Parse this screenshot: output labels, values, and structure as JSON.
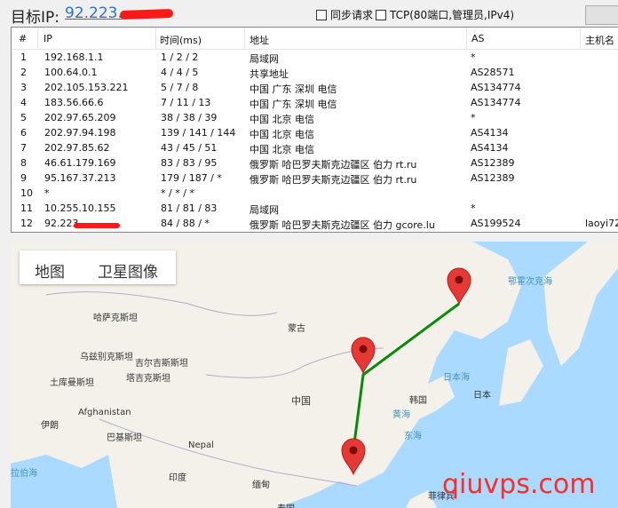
{
  "header": {
    "target_label": "目标IP:",
    "target_ip": "92.223.",
    "sync_label": "同步请求",
    "tcp_label": "TCP(80端口,管理员,IPv4)"
  },
  "table": {
    "columns": [
      "#",
      "IP",
      "时间(ms)",
      "地址",
      "AS",
      "主机名"
    ],
    "rows": [
      {
        "n": "1",
        "ip": "192.168.1.1",
        "time": "1 / 2 / 2",
        "addr": "局域网",
        "as": "*",
        "host": ""
      },
      {
        "n": "2",
        "ip": "100.64.0.1",
        "time": "4 / 4 / 5",
        "addr": "共享地址",
        "as": "AS28571",
        "host": ""
      },
      {
        "n": "3",
        "ip": "202.105.153.221",
        "time": "5 / 7 / 8",
        "addr": "中国 广东 深圳 电信",
        "as": "AS134774",
        "host": ""
      },
      {
        "n": "4",
        "ip": "183.56.66.6",
        "time": "7 / 11 / 13",
        "addr": "中国 广东 深圳 电信",
        "as": "AS134774",
        "host": ""
      },
      {
        "n": "5",
        "ip": "202.97.65.209",
        "time": "38 / 38 / 39",
        "addr": "中国 北京 电信",
        "as": "*",
        "host": ""
      },
      {
        "n": "6",
        "ip": "202.97.94.198",
        "time": "139 / 141 / 144",
        "addr": "中国 北京 电信",
        "as": "AS4134",
        "host": ""
      },
      {
        "n": "7",
        "ip": "202.97.85.62",
        "time": "43 / 45 / 51",
        "addr": "中国 北京 电信",
        "as": "AS4134",
        "host": ""
      },
      {
        "n": "8",
        "ip": "46.61.179.169",
        "time": "83 / 83 / 95",
        "addr": "俄罗斯 哈巴罗夫斯克边疆区 伯力 rt.ru",
        "as": "AS12389",
        "host": ""
      },
      {
        "n": "9",
        "ip": "95.167.37.213",
        "time": "179 / 187 / *",
        "addr": "俄罗斯 哈巴罗夫斯克边疆区 伯力 rt.ru",
        "as": "AS12389",
        "host": ""
      },
      {
        "n": "10",
        "ip": "*",
        "time": "* / * / *",
        "addr": "",
        "as": "",
        "host": ""
      },
      {
        "n": "11",
        "ip": "10.255.10.155",
        "time": "81 / 81 / 83",
        "addr": "局域网",
        "as": "*",
        "host": ""
      },
      {
        "n": "12",
        "ip": "92.223",
        "time": "84 / 88 / *",
        "addr": "俄罗斯 哈巴罗夫斯克边疆区 伯力 gcore.lu",
        "as": "AS199524",
        "host": "laoyi72."
      }
    ]
  },
  "map": {
    "tab_map": "地图",
    "tab_satellite": "卫星图像",
    "labels": {
      "kazakhstan": "哈萨克斯坦",
      "uzbekistan": "乌兹别克斯坦",
      "kyrgyzstan": "吉尔吉斯斯坦",
      "turkmenistan": "土库曼斯坦",
      "tajikistan": "塔吉克斯坦",
      "afghanistan": "Afghanistan",
      "iran": "伊朗",
      "pakistan": "巴基斯坦",
      "nepal": "Nepal",
      "india": "印度",
      "myanmar": "缅甸",
      "mongolia": "蒙古",
      "china": "中国",
      "korea": "韩国",
      "japan": "日本",
      "sea_of_japan": "日本海",
      "yellow_sea": "黄海",
      "east_sea": "东海",
      "okhotsk": "鄂霍次克海",
      "philippines": "菲律宾",
      "arabian_sea": "拉伯海",
      "thailand": "泰国"
    }
  },
  "watermark": "qiuvps.com",
  "colors": {
    "route": "#0a8a0a",
    "marker": "#e53935",
    "ip_link": "#2f6fd3"
  }
}
